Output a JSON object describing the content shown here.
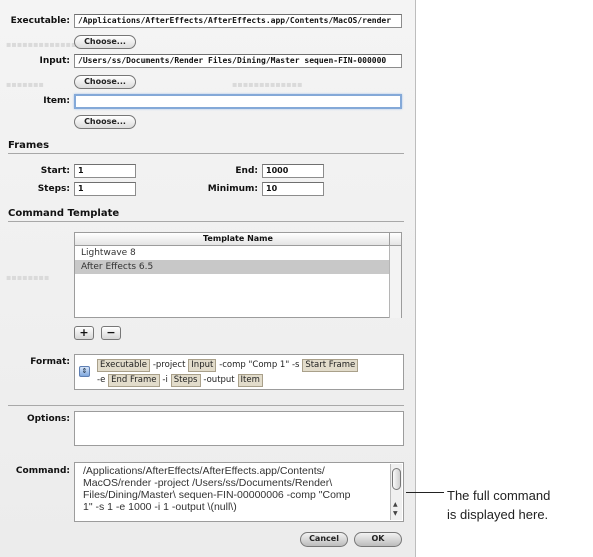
{
  "executable": {
    "label": "Executable:",
    "value": "/Applications/AfterEffects/AfterEffects.app/Contents/MacOS/render",
    "choose_label": "Choose..."
  },
  "input": {
    "label": "Input:",
    "value": "/Users/ss/Documents/Render Files/Dining/Master sequen-FIN-000000",
    "choose_label": "Choose..."
  },
  "item": {
    "label": "Item:",
    "value": "",
    "choose_label": "Choose..."
  },
  "frames": {
    "heading": "Frames",
    "start_label": "Start:",
    "start_value": "1",
    "end_label": "End:",
    "end_value": "1000",
    "steps_label": "Steps:",
    "steps_value": "1",
    "minimum_label": "Minimum:",
    "minimum_value": "10"
  },
  "command_template": {
    "heading": "Command Template",
    "column_header": "Template Name",
    "rows": [
      "Lightwave 8",
      "After Effects 6.5"
    ],
    "selected_index": 1,
    "add_label": "+",
    "remove_label": "−"
  },
  "format": {
    "label": "Format:",
    "line1": [
      {
        "type": "token",
        "text": "Executable"
      },
      {
        "type": "text",
        "text": "-project"
      },
      {
        "type": "token",
        "text": "Input"
      },
      {
        "type": "text",
        "text": "-comp \"Comp 1\" -s"
      },
      {
        "type": "token",
        "text": "Start Frame"
      }
    ],
    "line2": [
      {
        "type": "text",
        "text": "-e"
      },
      {
        "type": "token",
        "text": "End Frame"
      },
      {
        "type": "text",
        "text": "-i"
      },
      {
        "type": "token",
        "text": "Steps"
      },
      {
        "type": "text",
        "text": "-output"
      },
      {
        "type": "token",
        "text": "Item"
      }
    ]
  },
  "options": {
    "label": "Options:",
    "value": ""
  },
  "command": {
    "label": "Command:",
    "lines": [
      "/Applications/AfterEffects/AfterEffects.app/Contents/",
      "MacOS/render -project /Users/ss/Documents/Render\\",
      "Files/Dining/Master\\ sequen-FIN-00000006 -comp \"Comp",
      "1\" -s 1 -e 1000 -i 1 -output \\(null\\)"
    ]
  },
  "buttons": {
    "cancel": "Cancel",
    "ok": "OK"
  },
  "annotation": {
    "line1": "The full command",
    "line2": "is displayed here."
  },
  "colors": {
    "token_bg": "#e2dccb",
    "focus_ring": "#84a9d8",
    "selected_row": "#c8c8c8"
  }
}
